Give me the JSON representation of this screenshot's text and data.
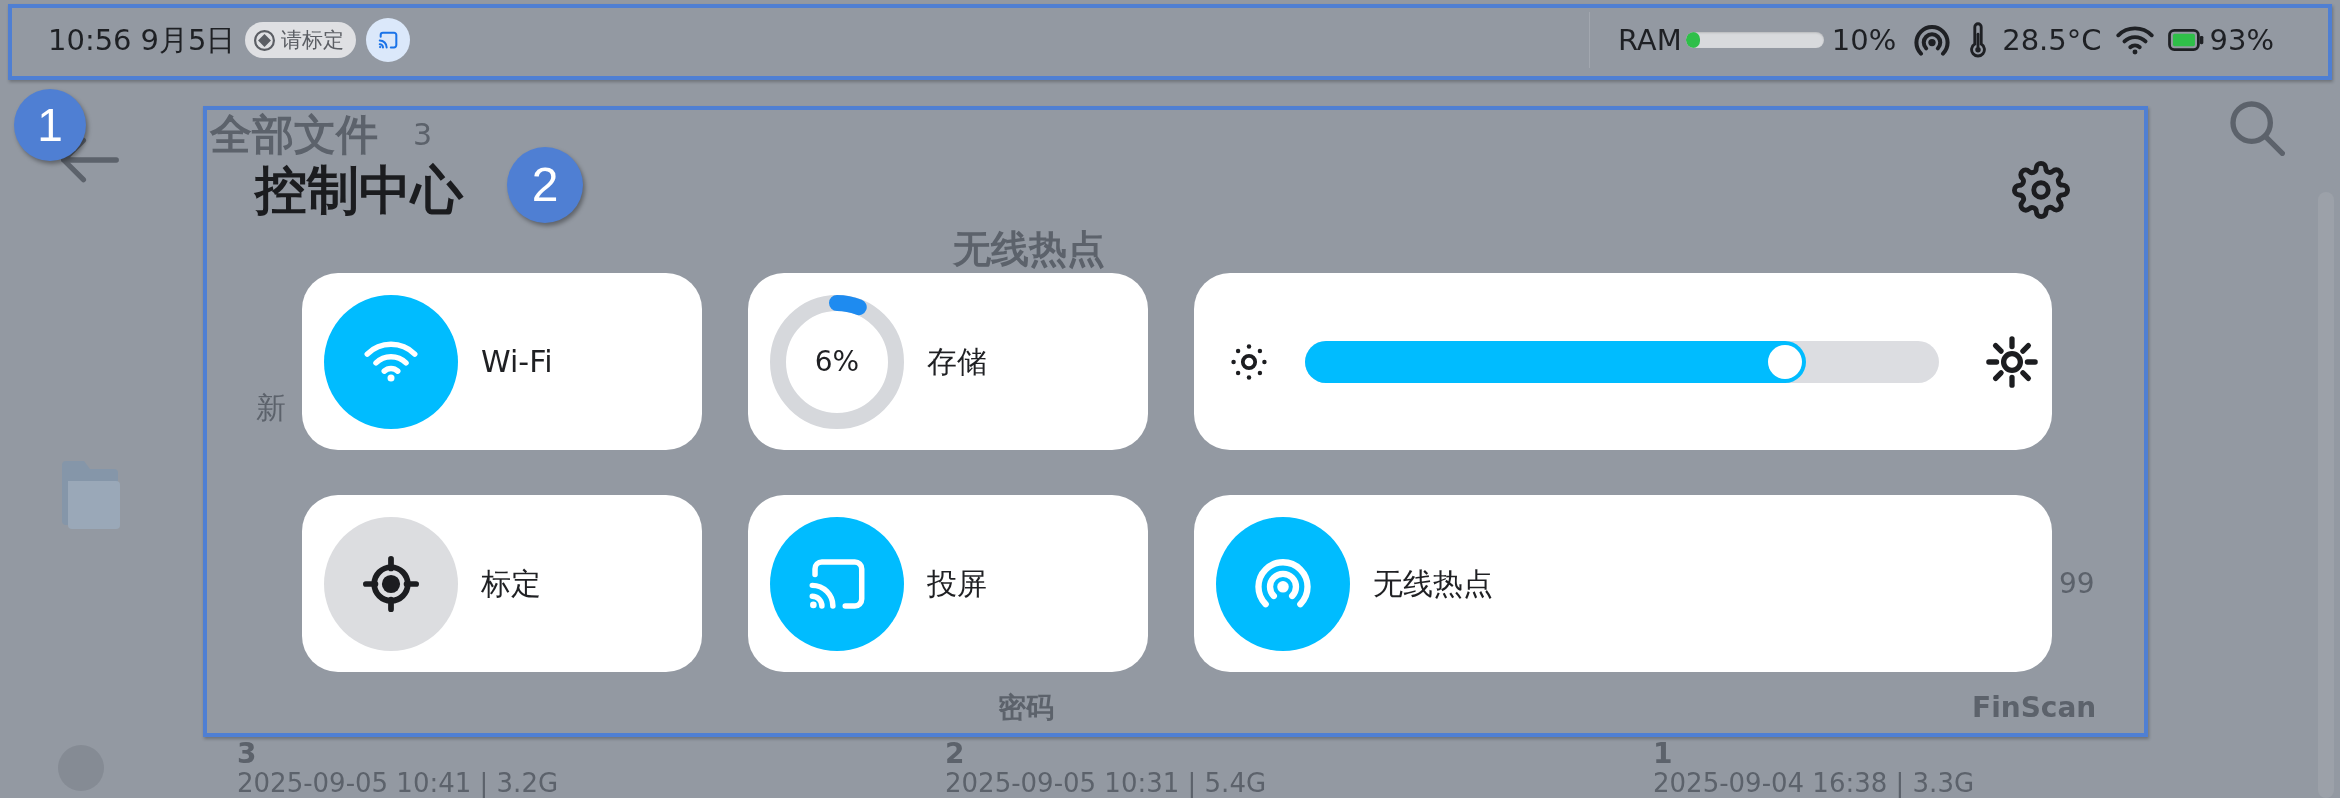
{
  "status_bar": {
    "time": "10:56",
    "date": "9月5日",
    "calibration_chip": "请标定",
    "ram": {
      "label": "RAM",
      "level": 0.1,
      "reading": "10%"
    },
    "temperature": "28.5°C",
    "battery": "93%"
  },
  "background_page": {
    "title": "全部文件",
    "count": "3",
    "panel_title": "无线热点",
    "fragment": "新",
    "side_fragment": "99",
    "files": [
      {
        "index": "3",
        "meta": "2025-09-05 10:41 | 3.2G"
      },
      {
        "name": "密码",
        "index": "2",
        "meta": "2025-09-05 10:31 | 5.4G"
      },
      {
        "name": "FinScan",
        "index": "1",
        "meta": "2025-09-04 16:38 | 3.3G"
      }
    ]
  },
  "control_center": {
    "title": "控制中心",
    "tiles": [
      {
        "kind": "wifi",
        "label": "Wi-Fi",
        "on": true
      },
      {
        "kind": "storage",
        "label": "存储",
        "reading": "6%",
        "level": 0.06
      },
      {
        "kind": "brightness",
        "level": 0.79
      },
      {
        "kind": "calibrate",
        "label": "标定",
        "on": false
      },
      {
        "kind": "cast",
        "label": "投屏",
        "on": true
      },
      {
        "kind": "hotspot",
        "label": "无线热点",
        "on": true
      }
    ]
  },
  "annotations": [
    {
      "label": "1"
    },
    {
      "label": "2"
    }
  ]
}
